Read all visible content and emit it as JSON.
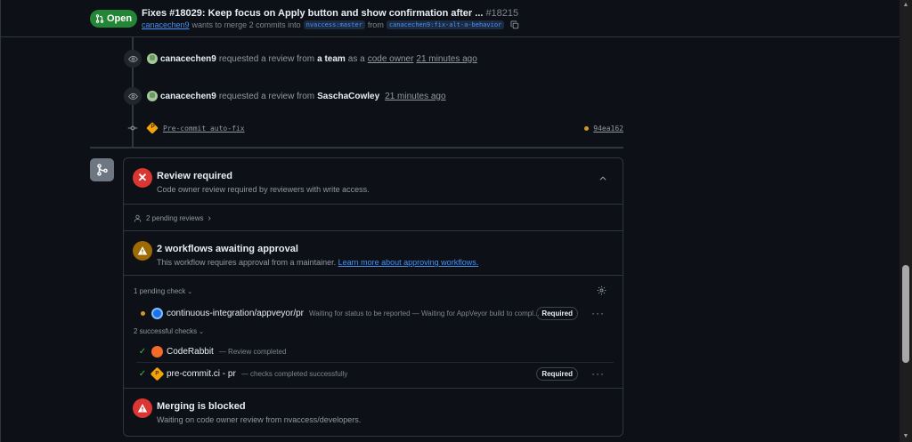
{
  "header": {
    "state_label": "Open",
    "title": "Fixes #18029: Keep focus on Apply button and show confirmation after ...",
    "number": "#18215",
    "author": "canacechen9",
    "meta_text": "wants to merge 2 commits into",
    "base_branch": "nvaccess:master",
    "from_text": "from",
    "head_branch": "canacechen9:fix-alt-a-behavior"
  },
  "timeline": [
    {
      "user": "canacechen9",
      "action": "requested a review from",
      "target": "a team",
      "extra": "as a",
      "extra_link": "code owner",
      "time": "21 minutes ago"
    },
    {
      "user": "canacechen9",
      "action": "requested a review from",
      "target": "SaschaCowley",
      "time": "21 minutes ago"
    }
  ],
  "commit": {
    "message": "Pre-commit auto-fix",
    "sha": "94ea162"
  },
  "merge_box": {
    "review": {
      "title": "Review required",
      "subtitle": "Code owner review required by reviewers with write access."
    },
    "pending_reviews": "2 pending reviews",
    "workflows": {
      "title": "2 workflows awaiting approval",
      "subtitle": "This workflow requires approval from a maintainer.",
      "link": "Learn more about approving workflows."
    },
    "pending_checks_label": "1 pending check",
    "successful_checks_label": "2 successful checks",
    "checks": [
      {
        "name": "continuous-integration/appveyor/pr",
        "desc": "Waiting for status to be reported — Waiting for AppVeyor build to compl...",
        "required": "Required",
        "state": "pending"
      },
      {
        "name": "CodeRabbit",
        "desc": "— Review completed",
        "required": "",
        "state": "success"
      },
      {
        "name": "pre-commit.ci - pr",
        "desc": "— checks completed successfully",
        "required": "Required",
        "state": "success"
      }
    ],
    "merging": {
      "title": "Merging is blocked",
      "subtitle": "Waiting on code owner review from nvaccess/developers."
    }
  },
  "colors": {
    "open_green": "#238636",
    "blocked_red": "#da3633",
    "pending_yellow": "#d29922",
    "link_blue": "#4493f8"
  }
}
